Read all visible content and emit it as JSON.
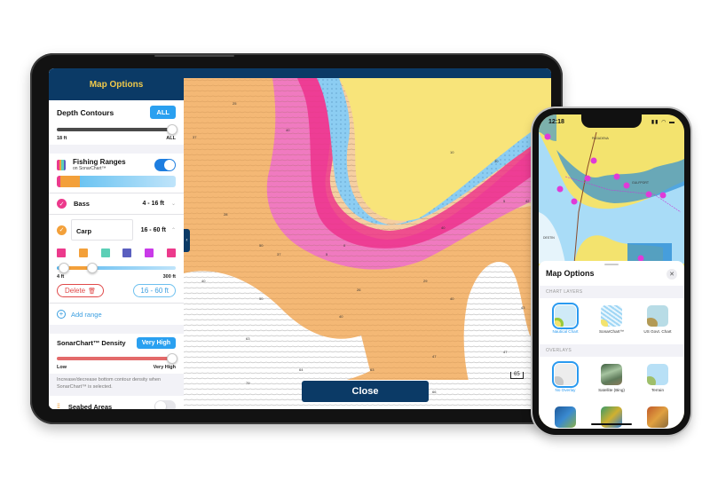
{
  "ipad": {
    "panel": {
      "title": "Map Options",
      "depth_contours": {
        "label": "Depth Contours",
        "button": "ALL",
        "slider_min_label": "18 ft",
        "slider_max_label": "ALL",
        "slider_value_fraction": 1.0
      },
      "fishing_ranges": {
        "label": "Fishing Ranges",
        "sublabel": "on SonarChart™",
        "enabled": true
      },
      "ranges": [
        {
          "name": "Bass",
          "range": "4 - 16 ft",
          "color": "#ec3a8c",
          "expanded": false
        },
        {
          "name": "Carp",
          "range": "16 - 60 ft",
          "color": "#f3a03a",
          "expanded": true
        }
      ],
      "swatches": [
        "#ec3a8c",
        "#f3a03a",
        "#5ccfb6",
        "#5a5fbf",
        "#c93ae8",
        "#ec3a8c"
      ],
      "carp_slider": {
        "min_label": "4 ft",
        "max_label": "300 ft",
        "low_fraction": 0.06,
        "high_fraction": 0.3
      },
      "delete_label": "Delete",
      "range_button": "16 - 60 ft",
      "add_range_label": "Add range",
      "density": {
        "label": "SonarChart™ Density",
        "button": "Very High",
        "min_label": "Low",
        "max_label": "Very High",
        "value_fraction": 1.0,
        "caption": "Increase/decrease bottom contour density when SonarChart™ is selected."
      },
      "seabed": {
        "label": "Seabed Areas",
        "enabled": false
      }
    },
    "map": {
      "close_label": "Close",
      "scale_label": "65",
      "depth_labels": [
        "25",
        "37",
        "40",
        "28",
        "50",
        "37",
        "5",
        "10",
        "40",
        "30",
        "5",
        "0",
        "26",
        "29",
        "40",
        "40",
        "50",
        "63",
        "40",
        "47",
        "64",
        "63",
        "79",
        "66",
        "47",
        "43",
        "33",
        "42"
      ]
    }
  },
  "iphone": {
    "status": {
      "time": "12:18",
      "icons": "▮▮ ◠ ▬"
    },
    "map_labels": [
      "PASADENA",
      "GULFPORT",
      "DESTIN"
    ],
    "sheet": {
      "title": "Map Options",
      "chart_layers_heading": "CHART LAYERS",
      "chart_layers": [
        {
          "label": "Nautical Chart",
          "selected": true
        },
        {
          "label": "SonarChart™",
          "selected": false
        },
        {
          "label": "US Govt. Chart",
          "selected": false
        }
      ],
      "overlays_heading": "OVERLAYS",
      "overlays": [
        {
          "label": "No Overlay",
          "selected": true
        },
        {
          "label": "Satellite (Bing)",
          "selected": false
        },
        {
          "label": "Terrain",
          "selected": false
        }
      ]
    }
  },
  "colors": {
    "navy": "#0b3a66",
    "accent_blue": "#2aa0f0",
    "header_gold": "#f0c94a",
    "delete_red": "#e04a4a"
  }
}
